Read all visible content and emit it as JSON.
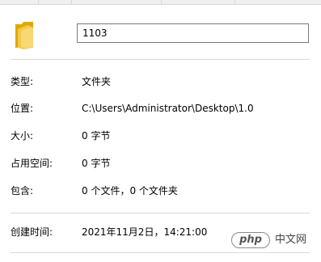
{
  "name_field": {
    "value": "1103"
  },
  "properties": {
    "type": {
      "label": "类型:",
      "value": "文件夹"
    },
    "location": {
      "label": "位置:",
      "value": "C:\\Users\\Administrator\\Desktop\\1.0"
    },
    "size": {
      "label": "大小:",
      "value": "0 字节"
    },
    "size_on_disk": {
      "label": "占用空间:",
      "value": "0 字节"
    },
    "contains": {
      "label": "包含:",
      "value": "0 个文件，0 个文件夹"
    },
    "created": {
      "label": "创建时间:",
      "value": "2021年11月2日，14:21:00"
    }
  },
  "watermark": {
    "logo_text": "php",
    "site_text": "中文网"
  },
  "colors": {
    "folder_body": "#f2c94c",
    "folder_front": "#f8d775",
    "border": "#7a7a7a",
    "divider": "#d9d9d9"
  },
  "icons": {
    "folder": "folder-icon"
  }
}
